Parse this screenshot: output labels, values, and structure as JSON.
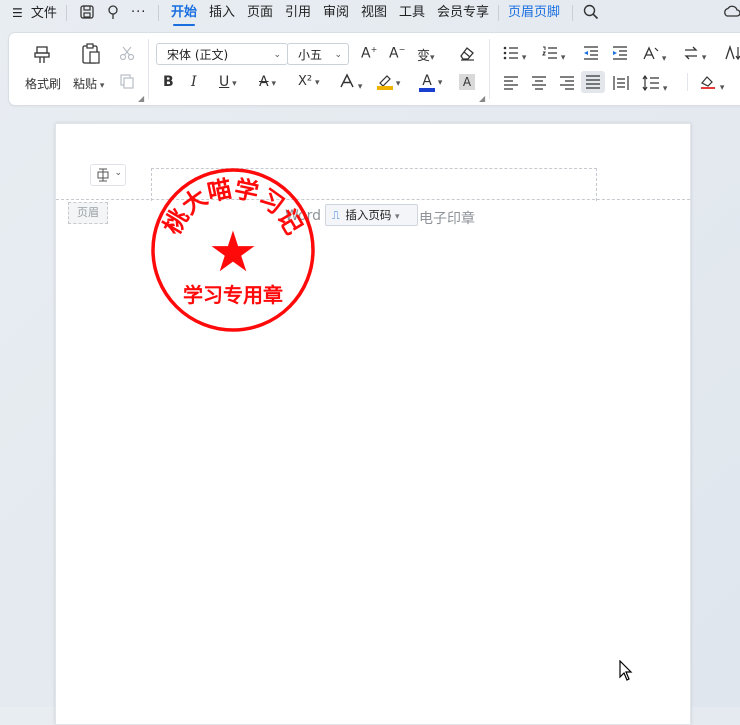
{
  "menu": {
    "file_label": "文件",
    "tabs": [
      {
        "label": "开始"
      },
      {
        "label": "插入"
      },
      {
        "label": "页面"
      },
      {
        "label": "引用"
      },
      {
        "label": "审阅"
      },
      {
        "label": "视图"
      },
      {
        "label": "工具"
      },
      {
        "label": "会员专享"
      },
      {
        "label": "页眉页脚"
      }
    ],
    "active_tab": "开始",
    "context_tab": "页眉页脚",
    "more_glyph": "···"
  },
  "ribbon": {
    "format_painter_label": "格式刷",
    "paste_label": "粘贴",
    "font_name": "宋体 (正文)",
    "font_size": "小五",
    "bold": "B",
    "italic": "I",
    "underline": "U",
    "strike": "A",
    "superscript": "X²",
    "font_color_letter": "A",
    "char_shading": "A",
    "highlight_color": "#f0b400",
    "font_color": "#1a3fd1"
  },
  "document": {
    "header_label": "页眉",
    "header_text_left": "Word",
    "header_text_right": "电子印章",
    "insert_page_number_label": "插入页码",
    "stamp": {
      "top_text": "桃大喵学习记",
      "bottom_text": "学习专用章",
      "color": "#ff0a0a",
      "center_glyph": "★"
    }
  }
}
